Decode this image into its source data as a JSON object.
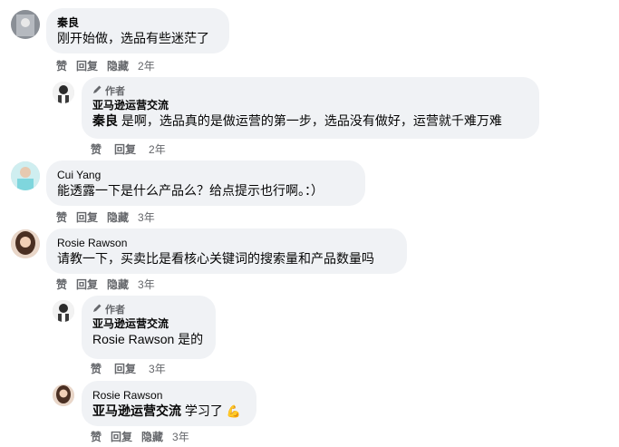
{
  "labels": {
    "like": "赞",
    "reply": "回复",
    "hide": "隐藏",
    "author_badge": "作者"
  },
  "comments": [
    {
      "name": "秦良",
      "text": "刚开始做，选品有些迷茫了",
      "time": "2年"
    },
    {
      "author_name": "亚马逊运营交流",
      "mention": "秦良",
      "text": " 是啊，选品真的是做运营的第一步，选品没有做好，运营就千难万难",
      "time": "2年"
    },
    {
      "name": "Cui Yang",
      "text": "能透露一下是什么产品么？给点提示也行啊。：）",
      "time": "3年"
    },
    {
      "name": "Rosie Rawson",
      "text": "请教一下，买卖比是看核心关键词的搜索量和产品数量吗",
      "time": "3年"
    },
    {
      "author_name": "亚马逊运营交流",
      "mention": "Rosie Rawson",
      "text": " 是的",
      "time": "3年"
    },
    {
      "name": "Rosie Rawson",
      "mention": "亚马逊运营交流",
      "text": " 学习了",
      "emoji": "💪",
      "time": "3年"
    }
  ]
}
